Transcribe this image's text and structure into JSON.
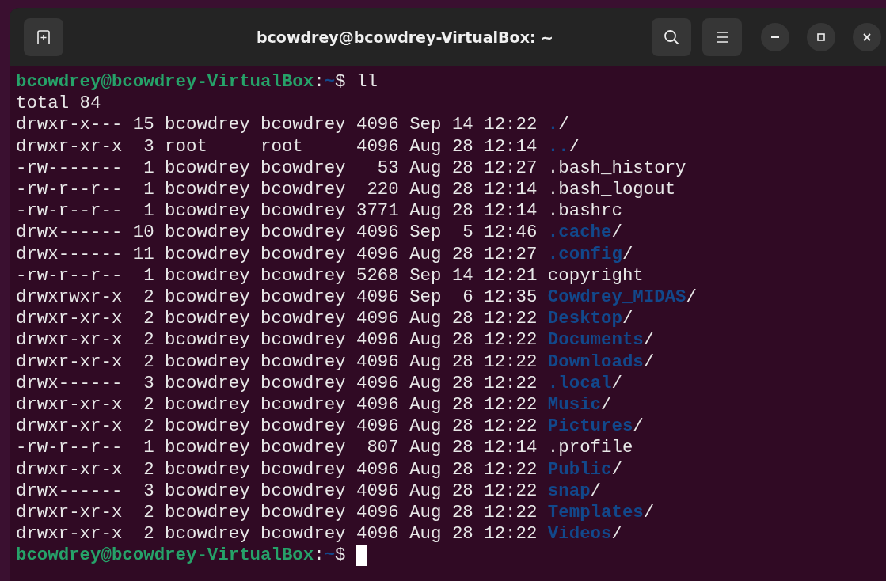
{
  "window": {
    "title": "bcowdrey@bcowdrey-VirtualBox: ~"
  },
  "prompts": [
    {
      "user_host": "bcowdrey@bcowdrey-VirtualBox",
      "sep": ":",
      "path": "~",
      "sigil": "$",
      "command": "ll"
    },
    {
      "user_host": "bcowdrey@bcowdrey-VirtualBox",
      "sep": ":",
      "path": "~",
      "sigil": "$"
    }
  ],
  "total": "total 84",
  "entries": [
    {
      "info": "drwxr-x--- 15 bcowdrey bcowdrey 4096 Sep 14 12:22 ",
      "name": ".",
      "suffix": "/",
      "kind": "dir"
    },
    {
      "info": "drwxr-xr-x  3 root     root     4096 Aug 28 12:14 ",
      "name": "..",
      "suffix": "/",
      "kind": "dir"
    },
    {
      "info": "-rw-------  1 bcowdrey bcowdrey   53 Aug 28 12:27 ",
      "name": ".bash_history",
      "kind": "file"
    },
    {
      "info": "-rw-r--r--  1 bcowdrey bcowdrey  220 Aug 28 12:14 ",
      "name": ".bash_logout",
      "kind": "file"
    },
    {
      "info": "-rw-r--r--  1 bcowdrey bcowdrey 3771 Aug 28 12:14 ",
      "name": ".bashrc",
      "kind": "file"
    },
    {
      "info": "drwx------ 10 bcowdrey bcowdrey 4096 Sep  5 12:46 ",
      "name": ".cache",
      "suffix": "/",
      "kind": "dir"
    },
    {
      "info": "drwx------ 11 bcowdrey bcowdrey 4096 Aug 28 12:27 ",
      "name": ".config",
      "suffix": "/",
      "kind": "dir"
    },
    {
      "info": "-rw-r--r--  1 bcowdrey bcowdrey 5268 Sep 14 12:21 ",
      "name": "copyright",
      "kind": "file"
    },
    {
      "info": "drwxrwxr-x  2 bcowdrey bcowdrey 4096 Sep  6 12:35 ",
      "name": "Cowdrey_MIDAS",
      "suffix": "/",
      "kind": "dir"
    },
    {
      "info": "drwxr-xr-x  2 bcowdrey bcowdrey 4096 Aug 28 12:22 ",
      "name": "Desktop",
      "suffix": "/",
      "kind": "dir"
    },
    {
      "info": "drwxr-xr-x  2 bcowdrey bcowdrey 4096 Aug 28 12:22 ",
      "name": "Documents",
      "suffix": "/",
      "kind": "dir"
    },
    {
      "info": "drwxr-xr-x  2 bcowdrey bcowdrey 4096 Aug 28 12:22 ",
      "name": "Downloads",
      "suffix": "/",
      "kind": "dir"
    },
    {
      "info": "drwx------  3 bcowdrey bcowdrey 4096 Aug 28 12:22 ",
      "name": ".local",
      "suffix": "/",
      "kind": "dir"
    },
    {
      "info": "drwxr-xr-x  2 bcowdrey bcowdrey 4096 Aug 28 12:22 ",
      "name": "Music",
      "suffix": "/",
      "kind": "dir"
    },
    {
      "info": "drwxr-xr-x  2 bcowdrey bcowdrey 4096 Aug 28 12:22 ",
      "name": "Pictures",
      "suffix": "/",
      "kind": "dir"
    },
    {
      "info": "-rw-r--r--  1 bcowdrey bcowdrey  807 Aug 28 12:14 ",
      "name": ".profile",
      "kind": "file"
    },
    {
      "info": "drwxr-xr-x  2 bcowdrey bcowdrey 4096 Aug 28 12:22 ",
      "name": "Public",
      "suffix": "/",
      "kind": "dir"
    },
    {
      "info": "drwx------  3 bcowdrey bcowdrey 4096 Aug 28 12:22 ",
      "name": "snap",
      "suffix": "/",
      "kind": "dir"
    },
    {
      "info": "drwxr-xr-x  2 bcowdrey bcowdrey 4096 Aug 28 12:22 ",
      "name": "Templates",
      "suffix": "/",
      "kind": "dir"
    },
    {
      "info": "drwxr-xr-x  2 bcowdrey bcowdrey 4096 Aug 28 12:22 ",
      "name": "Videos",
      "suffix": "/",
      "kind": "dir"
    }
  ]
}
